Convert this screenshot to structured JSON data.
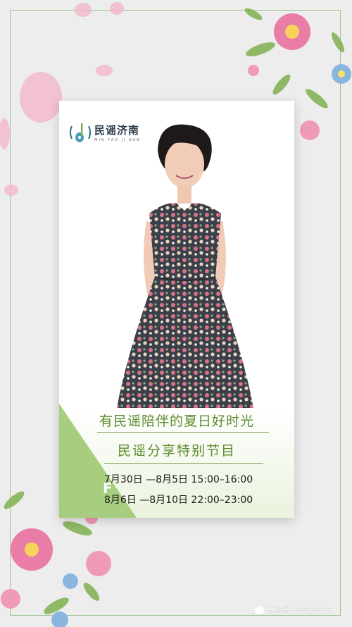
{
  "logo": {
    "name_cn": "民谣济南",
    "name_pinyin": "MIN YAO JI NAN"
  },
  "poster": {
    "title": "有民谣陪伴的夏日好时光",
    "subtitle": "民谣分享特别节目",
    "schedule": [
      "7月30日 —8月5日  15:00–16:00",
      "8月6日 —8月10日  22:00–23:00"
    ],
    "stray_letter": "F"
  },
  "watermark": {
    "text": "微信号: m521887"
  },
  "colors": {
    "frame": "#9ec48a",
    "accent_green": "#5c8c2c",
    "triangle": "#a7ce7e",
    "flower_pink": "#e98fb2",
    "leaf_green": "#7fb04f"
  }
}
